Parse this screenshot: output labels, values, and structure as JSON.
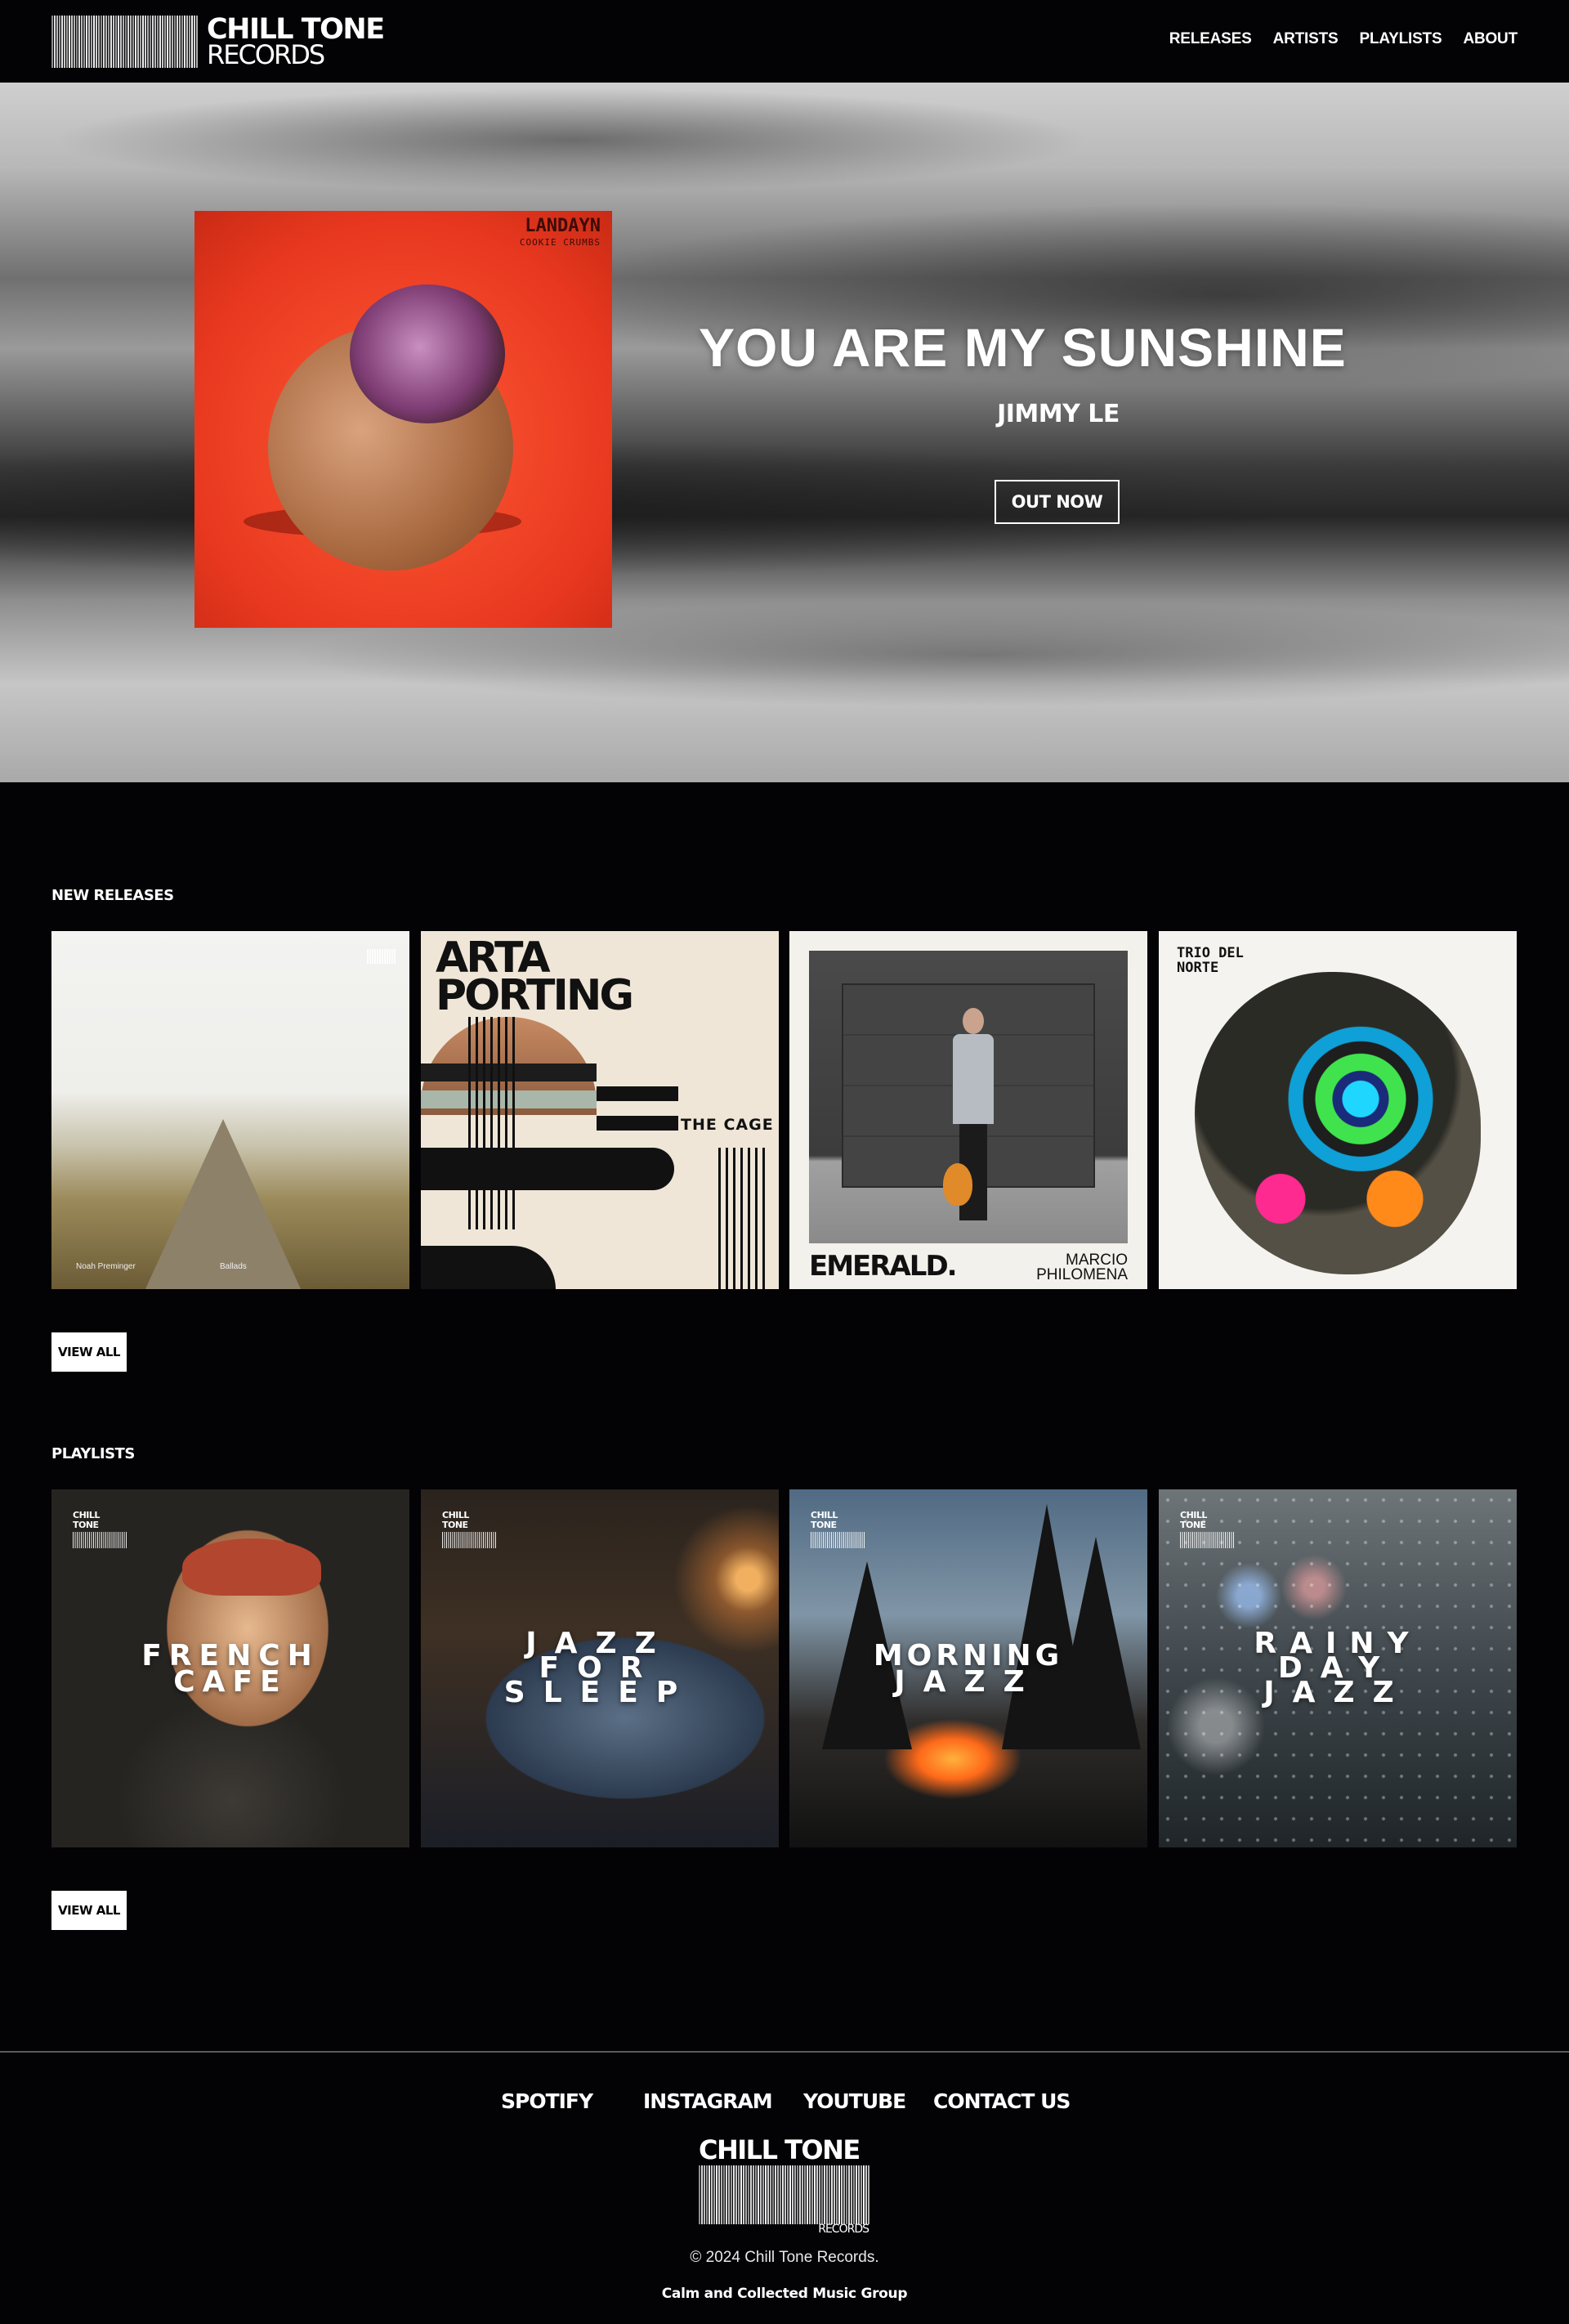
{
  "brand": {
    "name_line1": "CHILL TONE",
    "name_line2": "RECORDS"
  },
  "nav": {
    "items": [
      "RELEASES",
      "ARTISTS",
      "PLAYLISTS",
      "ABOUT"
    ]
  },
  "hero": {
    "cover": {
      "artist": "LANDAYN",
      "album": "COOKIE CRUMBS"
    },
    "title": "YOU ARE MY SUNSHINE",
    "artist": "JIMMY LE",
    "cta": "OUT NOW"
  },
  "new_releases": {
    "heading": "NEW RELEASES",
    "items": [
      {
        "caption_left": "Noah Preminger",
        "caption_right": "Ballads"
      },
      {
        "title_line1": "ARTA",
        "title_line2": "PORTING",
        "subtitle": "THE CAGE"
      },
      {
        "title": "EMERALD.",
        "artist_line1": "MARCIO",
        "artist_line2": "PHILOMENA"
      },
      {
        "name_line1": "TRIO DEL",
        "name_line2": "NORTE"
      }
    ],
    "view_all": "VIEW ALL"
  },
  "playlists": {
    "heading": "PLAYLISTS",
    "logo_text": "CHILL TONE",
    "items": [
      {
        "line1": "FRENCH",
        "line2": "CAFE",
        "line3": ""
      },
      {
        "line1": "JAZZ",
        "line2": "FOR",
        "line3": "SLEEP"
      },
      {
        "line1": "MORNING",
        "line2": "JAZZ",
        "line3": ""
      },
      {
        "line1": "RAINY",
        "line2": "DAY",
        "line3": "JAZZ"
      }
    ],
    "view_all": "VIEW ALL"
  },
  "footer": {
    "links": [
      "SPOTIFY",
      "INSTAGRAM",
      "YOUTUBE",
      "CONTACT US"
    ],
    "logo_line1": "CHILL TONE",
    "logo_line2": "RECORDS",
    "copyright": "© 2024 Chill Tone Records.",
    "tagline": "Calm and Collected Music Group"
  }
}
